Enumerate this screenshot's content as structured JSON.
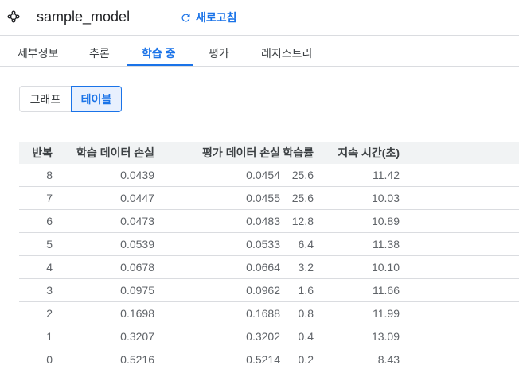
{
  "header": {
    "title": "sample_model",
    "refresh_label": "새로고침"
  },
  "tabs": [
    "세부정보",
    "추론",
    "학습 중",
    "평가",
    "레지스트리"
  ],
  "active_tab": "학습 중",
  "view_toggle": {
    "graph": "그래프",
    "table": "테이블",
    "selected": "테이블"
  },
  "table": {
    "columns": [
      "반복",
      "학습 데이터 손실",
      "평가 데이터 손실",
      "학습률",
      "지속 시간(초)"
    ],
    "rows": [
      [
        "8",
        "0.0439",
        "0.0454",
        "25.6",
        "11.42"
      ],
      [
        "7",
        "0.0447",
        "0.0455",
        "25.6",
        "10.03"
      ],
      [
        "6",
        "0.0473",
        "0.0483",
        "12.8",
        "10.89"
      ],
      [
        "5",
        "0.0539",
        "0.0533",
        "6.4",
        "11.38"
      ],
      [
        "4",
        "0.0678",
        "0.0664",
        "3.2",
        "10.10"
      ],
      [
        "3",
        "0.0975",
        "0.0962",
        "1.6",
        "11.66"
      ],
      [
        "2",
        "0.1698",
        "0.1688",
        "0.8",
        "11.99"
      ],
      [
        "1",
        "0.3207",
        "0.3202",
        "0.4",
        "13.09"
      ],
      [
        "0",
        "0.5216",
        "0.5214",
        "0.2",
        "8.43"
      ]
    ]
  }
}
